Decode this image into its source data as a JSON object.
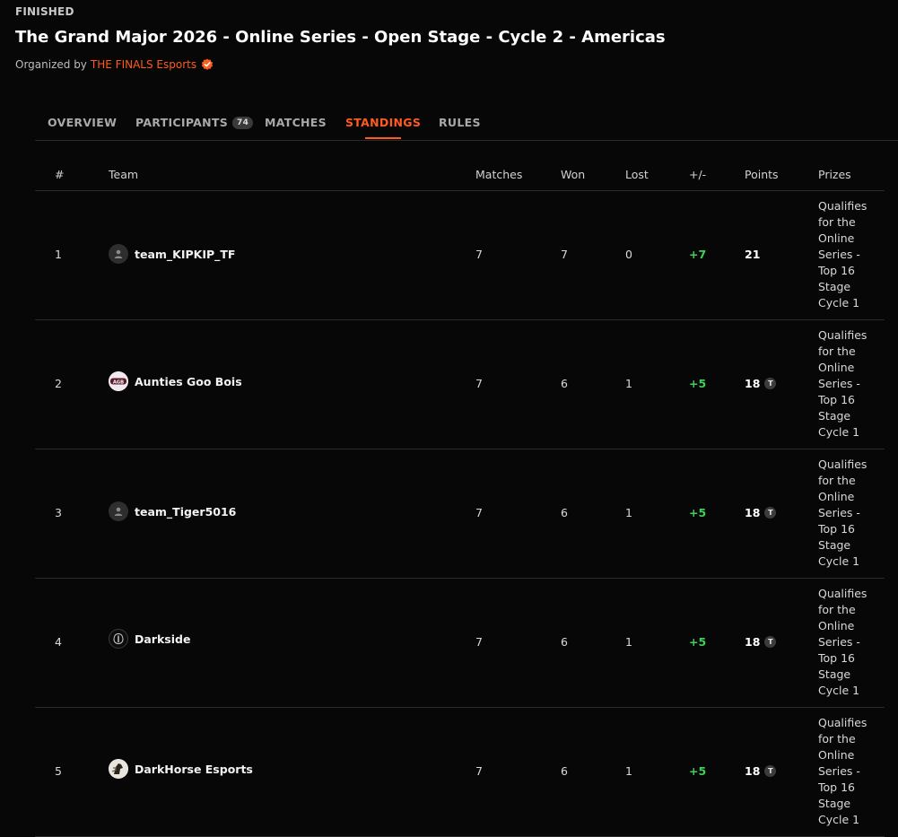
{
  "header": {
    "status": "FINISHED",
    "title": "The Grand Major 2026 - Online Series - Open Stage - Cycle 2 - Americas",
    "organized_by": "Organized by",
    "organizer": "THE FINALS Esports"
  },
  "tabs": [
    {
      "label": "OVERVIEW"
    },
    {
      "label": "PARTICIPANTS",
      "count": "74"
    },
    {
      "label": "MATCHES"
    },
    {
      "label": "STANDINGS",
      "active": true
    },
    {
      "label": "RULES"
    }
  ],
  "table": {
    "headers": {
      "rank": "#",
      "team": "Team",
      "matches": "Matches",
      "won": "Won",
      "lost": "Lost",
      "diff": "+/-",
      "points": "Points",
      "prizes": "Prizes"
    },
    "tiebreak_badge": "T",
    "rows": [
      {
        "rank": "1",
        "team": "team_KIPKIP_TF",
        "avatar": "default-user-icon",
        "matches": "7",
        "won": "7",
        "lost": "0",
        "diff": "+7",
        "points": "21",
        "tiebreak": false,
        "prize": "Qualifies for the Online Series - Top 16 Stage Cycle 1"
      },
      {
        "rank": "2",
        "team": "Aunties Goo Bois",
        "avatar": "agb-logo",
        "matches": "7",
        "won": "6",
        "lost": "1",
        "diff": "+5",
        "points": "18",
        "tiebreak": true,
        "prize": "Qualifies for the Online Series - Top 16 Stage Cycle 1"
      },
      {
        "rank": "3",
        "team": "team_Tiger5016",
        "avatar": "default-user-icon",
        "matches": "7",
        "won": "6",
        "lost": "1",
        "diff": "+5",
        "points": "18",
        "tiebreak": true,
        "prize": "Qualifies for the Online Series - Top 16 Stage Cycle 1"
      },
      {
        "rank": "4",
        "team": "Darkside",
        "avatar": "darkside-logo",
        "matches": "7",
        "won": "6",
        "lost": "1",
        "diff": "+5",
        "points": "18",
        "tiebreak": true,
        "prize": "Qualifies for the Online Series - Top 16 Stage Cycle 1"
      },
      {
        "rank": "5",
        "team": "DarkHorse Esports",
        "avatar": "darkhorse-logo",
        "matches": "7",
        "won": "6",
        "lost": "1",
        "diff": "+5",
        "points": "18",
        "tiebreak": true,
        "prize": "Qualifies for the Online Series - Top 16 Stage Cycle 1"
      }
    ]
  },
  "colors": {
    "accent": "#ff5a1f",
    "positive": "#3fd15a",
    "background": "#070707"
  }
}
